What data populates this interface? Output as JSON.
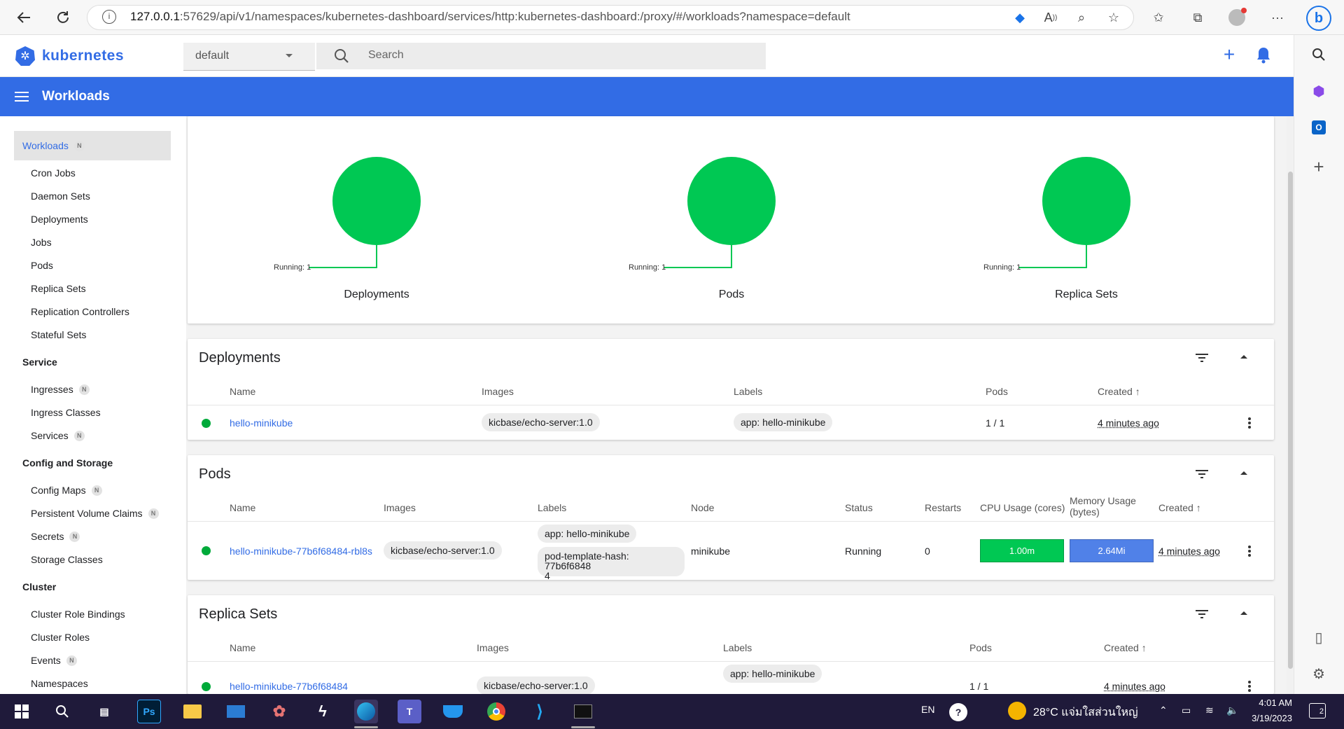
{
  "browser": {
    "url_host": "127.0.0.1",
    "url_rest": ":57629/api/v1/namespaces/kubernetes-dashboard/services/http:kubernetes-dashboard:/proxy/#/workloads?namespace=default"
  },
  "header": {
    "logo_text": "kubernetes",
    "namespace": "default",
    "search_placeholder": "Search"
  },
  "toolbar": {
    "title": "Workloads"
  },
  "nav": {
    "workloads": {
      "label": "Workloads",
      "badge": "N"
    },
    "workload_items": [
      "Cron Jobs",
      "Daemon Sets",
      "Deployments",
      "Jobs",
      "Pods",
      "Replica Sets",
      "Replication Controllers",
      "Stateful Sets"
    ],
    "service_section": "Service",
    "service_items": [
      {
        "label": "Ingresses",
        "badge": "N"
      },
      {
        "label": "Ingress Classes",
        "badge": ""
      },
      {
        "label": "Services",
        "badge": "N"
      }
    ],
    "config_section": "Config and Storage",
    "config_items": [
      {
        "label": "Config Maps",
        "badge": "N"
      },
      {
        "label": "Persistent Volume Claims",
        "badge": "N"
      },
      {
        "label": "Secrets",
        "badge": "N"
      },
      {
        "label": "Storage Classes",
        "badge": ""
      }
    ],
    "cluster_section": "Cluster",
    "cluster_items": [
      {
        "label": "Cluster Role Bindings",
        "badge": ""
      },
      {
        "label": "Cluster Roles",
        "badge": ""
      },
      {
        "label": "Events",
        "badge": "N"
      },
      {
        "label": "Namespaces",
        "badge": ""
      }
    ]
  },
  "status_charts": [
    {
      "title": "Deployments",
      "label": "Running: 1",
      "running": 1
    },
    {
      "title": "Pods",
      "label": "Running: 1",
      "running": 1
    },
    {
      "title": "Replica Sets",
      "label": "Running: 1",
      "running": 1
    }
  ],
  "deployments": {
    "title": "Deployments",
    "columns": [
      "Name",
      "Images",
      "Labels",
      "Pods",
      "Created"
    ],
    "rows": [
      {
        "name": "hello-minikube",
        "image": "kicbase/echo-server:1.0",
        "label": "app: hello-minikube",
        "pods": "1 / 1",
        "created": "4 minutes ago"
      }
    ]
  },
  "pods": {
    "title": "Pods",
    "columns": [
      "Name",
      "Images",
      "Labels",
      "Node",
      "Status",
      "Restarts",
      "CPU Usage (cores)",
      "Memory Usage (bytes)",
      "Created"
    ],
    "rows": [
      {
        "name": "hello-minikube-77b6f68484-rbl8s",
        "image": "kicbase/echo-server:1.0",
        "label1": "app: hello-minikube",
        "label2": "pod-template-hash: 77b6f6848",
        "label2_cont": "4",
        "node": "minikube",
        "status": "Running",
        "restarts": "0",
        "cpu": "1.00m",
        "memory": "2.64Mi",
        "created": "4 minutes ago"
      }
    ]
  },
  "replica_sets": {
    "title": "Replica Sets",
    "columns": [
      "Name",
      "Images",
      "Labels",
      "Pods",
      "Created"
    ],
    "rows": [
      {
        "name": "hello-minikube-77b6f68484",
        "image": "kicbase/echo-server:1.0",
        "label": "app: hello-minikube",
        "pods": "1 / 1",
        "created": "4 minutes ago"
      }
    ]
  },
  "taskbar": {
    "apps": [
      "start",
      "search",
      "task-view",
      "photoshop",
      "file-explorer",
      "mail",
      "paint",
      "app-bolt",
      "edge",
      "teams",
      "docker",
      "chrome",
      "vscode",
      "terminal"
    ],
    "lang": "EN",
    "weather": "28°C  แจ่มใสส่วนใหญ่",
    "time": "4:01 AM",
    "date": "3/19/2023"
  },
  "colors": {
    "k8s_blue": "#326ce5",
    "green": "#00c853",
    "status_dot": "#00aa3a"
  }
}
